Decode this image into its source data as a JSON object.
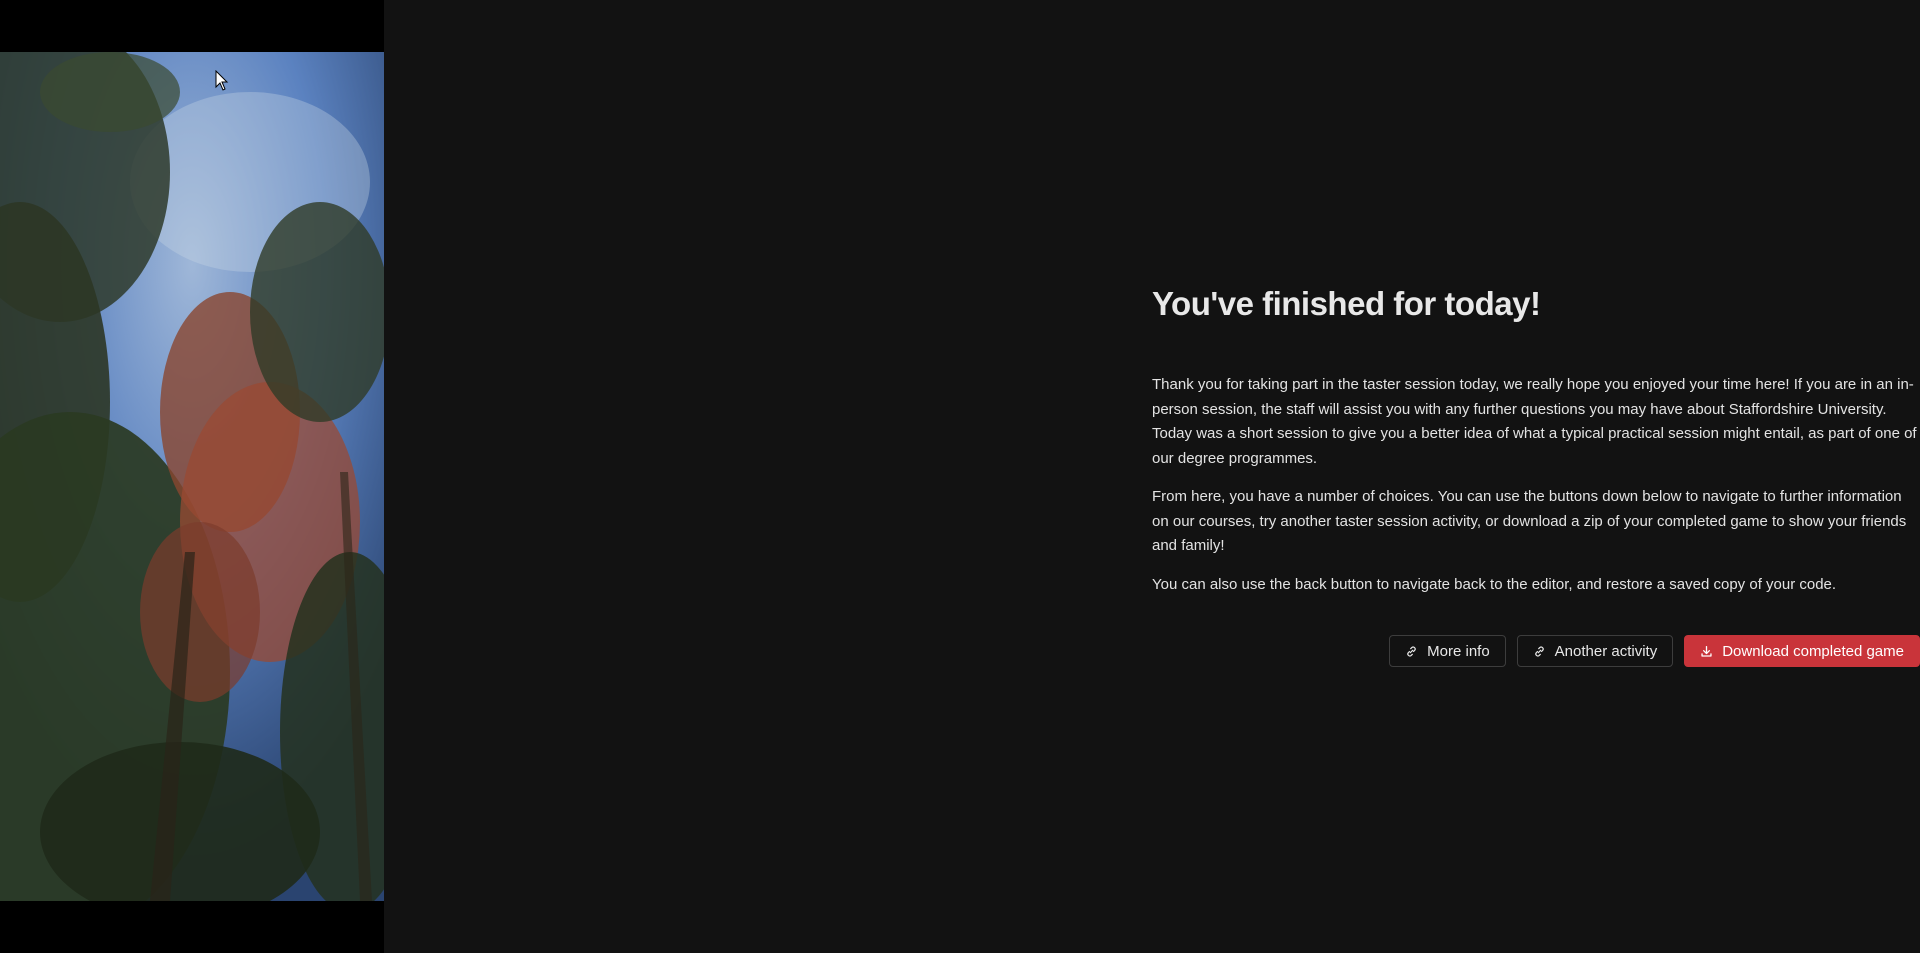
{
  "page": {
    "title": "You've finished for today!",
    "paragraphs": [
      "Thank you for taking part in the taster session today, we really hope you enjoyed your time here! If you are in an in-person session, the staff will assist you with any further questions you may have about Staffordshire University. Today was a short session to give you a better idea of what a typical practical session might entail, as part of one of our degree programmes.",
      "From here, you have a number of choices. You can use the buttons down below to navigate to further information on our courses, try another taster session activity, or download a zip of your completed game to show your friends and family!",
      "You can also use the back button to navigate back to the editor, and restore a saved copy of your code."
    ]
  },
  "actions": {
    "more_info": {
      "label": "More info",
      "icon": "link-icon"
    },
    "another_activity": {
      "label": "Another activity",
      "icon": "link-icon"
    },
    "download": {
      "label": "Download completed game",
      "icon": "download-icon"
    }
  },
  "colors": {
    "background": "#121212",
    "primary": "#c9343a",
    "text": "#e3e3e3"
  }
}
